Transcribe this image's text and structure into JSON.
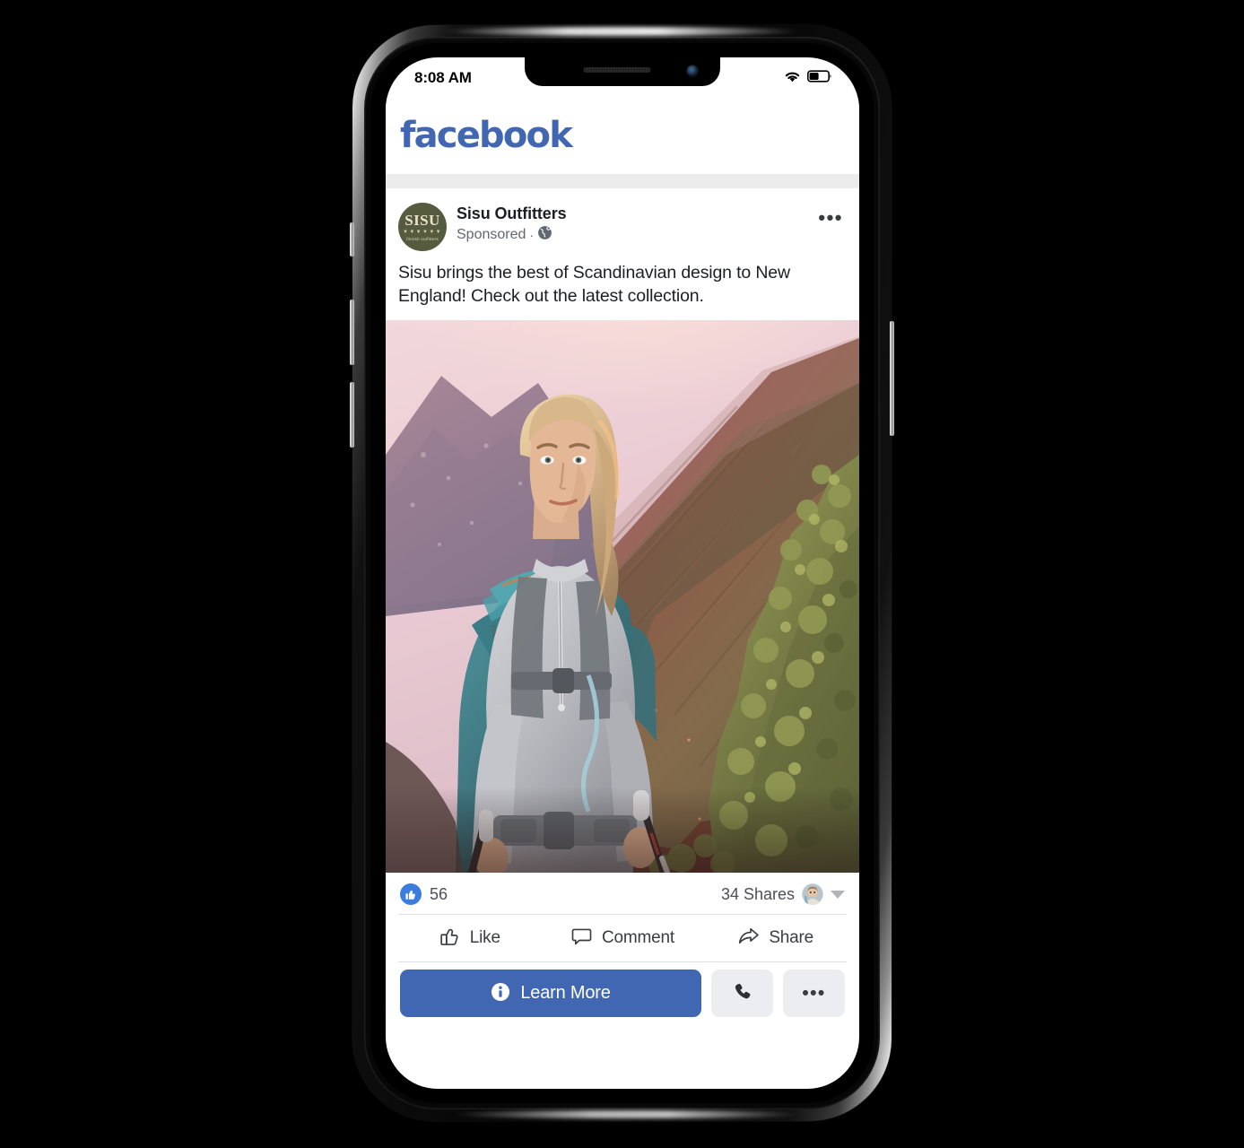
{
  "device": {
    "status_bar": {
      "time": "8:08 AM",
      "wifi_icon": "wifi-icon",
      "battery_icon": "battery-icon",
      "battery_level_percent": 50
    },
    "hardware": {
      "speaker_grille": "speaker-grille",
      "front_camera": "front-camera",
      "buttons": [
        "silence-switch",
        "volume-up",
        "volume-down",
        "power"
      ]
    }
  },
  "app": {
    "header": {
      "wordmark": "facebook",
      "brand_color": "#4267B2"
    }
  },
  "post": {
    "avatar": {
      "brand_word": "SISU",
      "brand_dots": "▼▼▼▼▼▼",
      "brand_tagline": "finnish outfitters",
      "bg_color": "#565a3e",
      "text_color": "#e8e3c8"
    },
    "page_name": "Sisu Outfitters",
    "sponsored_label": "Sponsored",
    "separator_dot": "·",
    "audience_icon": "globe-icon",
    "overflow_menu": "•••",
    "body_text": "Sisu brings the best of Scandinavian design to New England! Check out the latest collection.",
    "image": {
      "alt": "woman-hiking-with-backpack-at-sunset",
      "sky_color": "#e8d3dd",
      "ridge_color": "#7a5a57",
      "foliage_color": "#7f8a4e",
      "jacket_color": "#b9c1c8",
      "backpack_color": "#2f7f8c"
    }
  },
  "engagement": {
    "reaction_icon": "thumbs-up-filled-icon",
    "reaction_color": "#3b7ddd",
    "like_count": "56",
    "shares_text": "34 Shares",
    "sharer_avatar": "sharer-avatar",
    "dropdown_caret": "caret-down-icon",
    "actions": [
      {
        "label": "Like",
        "icon": "thumbs-up-outline-icon"
      },
      {
        "label": "Comment",
        "icon": "comment-bubble-icon"
      },
      {
        "label": "Share",
        "icon": "share-arrow-icon"
      }
    ]
  },
  "cta": {
    "primary_label": "Learn More",
    "primary_icon": "info-circle-icon",
    "primary_color": "#4267B2",
    "call_icon": "phone-handset-icon",
    "more_label": "•••"
  }
}
